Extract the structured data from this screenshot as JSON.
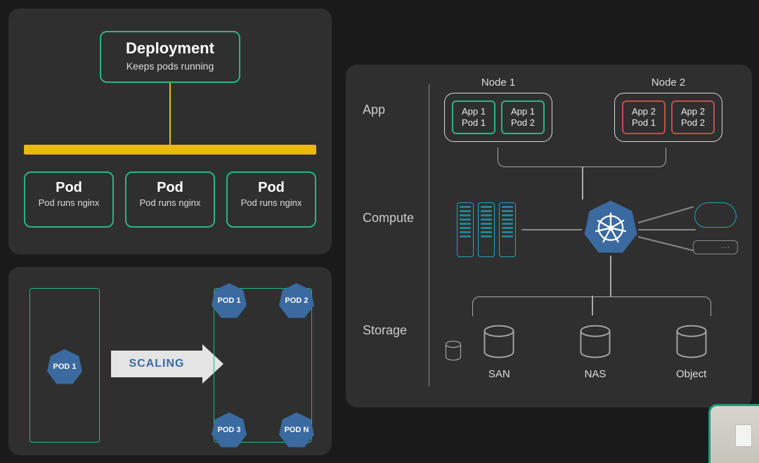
{
  "deployment": {
    "title": "Deployment",
    "subtitle": "Keeps pods running",
    "pods": [
      {
        "title": "Pod",
        "subtitle": "Pod runs nginx"
      },
      {
        "title": "Pod",
        "subtitle": "Pod runs nginx"
      },
      {
        "title": "Pod",
        "subtitle": "Pod runs nginx"
      }
    ]
  },
  "scaling": {
    "source_pod": "POD 1",
    "arrow_label": "SCALING",
    "target_pods": [
      "POD 1",
      "POD 2",
      "POD 3",
      "POD N"
    ]
  },
  "arch": {
    "sections": {
      "app": "App",
      "compute": "Compute",
      "storage": "Storage"
    },
    "nodes": [
      {
        "title": "Node 1",
        "style": "green",
        "pods": [
          {
            "app": "App 1",
            "pod": "Pod 1"
          },
          {
            "app": "App 1",
            "pod": "Pod 2"
          }
        ]
      },
      {
        "title": "Node 2",
        "style": "red",
        "pods": [
          {
            "app": "App 2",
            "pod": "Pod 1"
          },
          {
            "app": "App 2",
            "pod": "Pod 2"
          }
        ]
      }
    ],
    "storage": [
      "SAN",
      "NAS",
      "Object"
    ]
  }
}
